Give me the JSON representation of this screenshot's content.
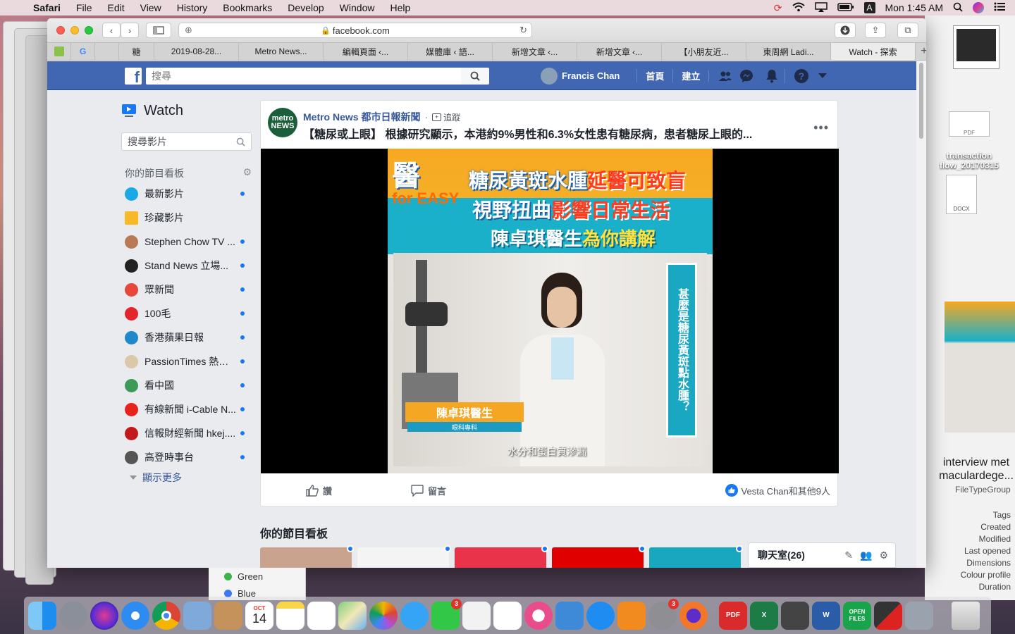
{
  "menubar": {
    "app": "Safari",
    "items": [
      "File",
      "Edit",
      "View",
      "History",
      "Bookmarks",
      "Develop",
      "Window",
      "Help"
    ],
    "time": "Mon 1:45 AM",
    "input_source": "A"
  },
  "browser": {
    "url": "facebook.com",
    "tabs": [
      "糖",
      "2019-08-28...",
      "Metro News...",
      "編輯頁面 ‹...",
      "媒體庫 ‹ 語...",
      "新增文章 ‹...",
      "新增文章 ‹...",
      "【小朋友近...",
      "東周網 Ladi...",
      "Watch - 探索"
    ],
    "active_tab_index": 9
  },
  "fb": {
    "search_placeholder": "搜尋",
    "user_name": "Francis Chan",
    "nav_home": "首頁",
    "nav_create": "建立"
  },
  "sidebar": {
    "title": "Watch",
    "search_placeholder": "搜尋影片",
    "section": "你的節目看板",
    "items": [
      {
        "label": "最新影片",
        "color": "#1aa9e6",
        "dot": true
      },
      {
        "label": "珍藏影片",
        "color": "#f7b928",
        "dot": false
      },
      {
        "label": "Stephen Chow TV ...",
        "color": "#b87a56",
        "dot": true
      },
      {
        "label": "Stand News 立場...",
        "color": "#222222",
        "dot": true
      },
      {
        "label": "眾新聞",
        "color": "#e7483a",
        "dot": true
      },
      {
        "label": "100毛",
        "color": "#e3262b",
        "dot": true
      },
      {
        "label": "香港蘋果日報",
        "color": "#1e88c8",
        "dot": true
      },
      {
        "label": "PassionTimes 熱血...",
        "color": "#d9c9a8",
        "dot": true
      },
      {
        "label": "看中國",
        "color": "#3e9b57",
        "dot": true
      },
      {
        "label": "有線新聞 i-Cable N...",
        "color": "#e8231c",
        "dot": true
      },
      {
        "label": "信報財經新聞 hkej....",
        "color": "#c4191c",
        "dot": true
      },
      {
        "label": "高登時事台",
        "color": "#555555",
        "dot": true
      }
    ],
    "show_more": "顯示更多"
  },
  "post": {
    "page_name": "Metro News 都市日報新聞",
    "follow": "追蹤",
    "logo_text": "metro NEWS",
    "title": "【糖尿或上眼】 根據研究顯示，本港約9%男性和6.3%女性患有糖尿病，患者糖尿上眼的...",
    "video": {
      "logo": "醫",
      "logo_sub": "for EASY",
      "line1_a": "糖尿黃斑水腫",
      "line1_b": "延醫可致盲",
      "line2_a": "視野扭曲",
      "line2_b": "影響日常生活",
      "line3_a": "陳卓琪醫生",
      "line3_b": "為你講解",
      "side_caption": "甚麼是糖尿黃斑點水腫？",
      "name_tag": "陳卓琪醫生",
      "role_tag": "眼科專科",
      "subtitle": "水分和蛋白質滲漏"
    },
    "like": "讚",
    "comment": "留言",
    "likes_text": "Vesta Chan和其他9人"
  },
  "section2_title": "你的節目看板",
  "tile_colors": [
    "#c9a38d",
    "#f4f4f4",
    "#e8334a",
    "#e00000",
    "#19a7c0"
  ],
  "chat": {
    "label": "聊天室(26)"
  },
  "desktop": {
    "file1": "transaction flow_20170315",
    "file1_type": "PDF",
    "file2_type": "DOCX",
    "preview_title": "interview met maculardege...",
    "preview_group": "FileTypeGroup",
    "info_labels": [
      "Tags",
      "Created",
      "Modified",
      "Last opened",
      "Dimensions",
      "Colour profile",
      "Duration"
    ],
    "finder_tags": [
      "Green",
      "Blue"
    ]
  },
  "dock": {
    "calendar_month": "OCT",
    "calendar_day": "14",
    "badges": {
      "facetime": "3",
      "sysprefs": "3"
    },
    "pdf_label": "PDF",
    "open_files_label": "OPEN FILES"
  }
}
